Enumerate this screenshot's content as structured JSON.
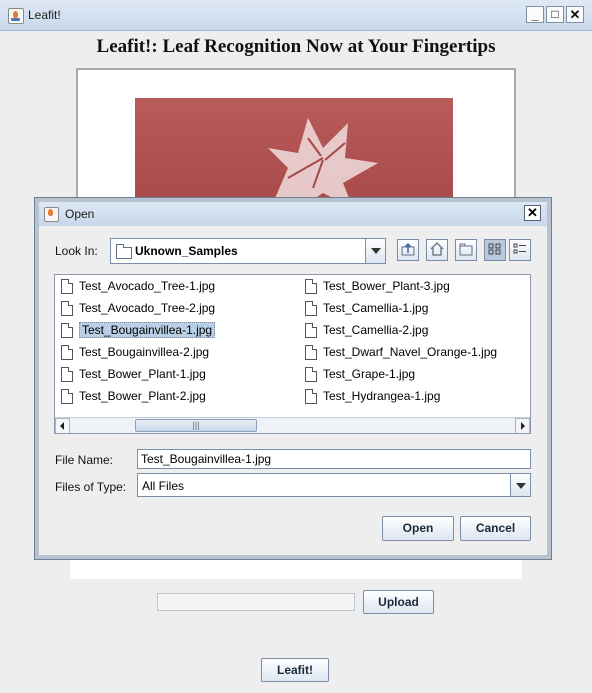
{
  "window": {
    "title": "Leafit!",
    "minimize": "_",
    "maximize": "□",
    "close": "✕"
  },
  "heading": "Leafit!: Leaf Recognition Now at Your Fingertips",
  "upload": {
    "button_label": "Upload",
    "field_value": ""
  },
  "leafit_button": "Leafit!",
  "dialog": {
    "title": "Open",
    "close": "✕",
    "look_in_label": "Look In:",
    "look_in_value": "Uknown_Samples",
    "files_left": [
      "Test_Avocado_Tree-1.jpg",
      "Test_Avocado_Tree-2.jpg",
      "Test_Bougainvillea-1.jpg",
      "Test_Bougainvillea-2.jpg",
      "Test_Bower_Plant-1.jpg",
      "Test_Bower_Plant-2.jpg"
    ],
    "files_right": [
      "Test_Bower_Plant-3.jpg",
      "Test_Camellia-1.jpg",
      "Test_Camellia-2.jpg",
      "Test_Dwarf_Navel_Orange-1.jpg",
      "Test_Grape-1.jpg",
      "Test_Hydrangea-1.jpg"
    ],
    "selected_file": "Test_Bougainvillea-1.jpg",
    "file_name_label": "File Name:",
    "file_name_value": "Test_Bougainvillea-1.jpg",
    "files_of_type_label": "Files of Type:",
    "files_of_type_value": "All Files",
    "open_button": "Open",
    "cancel_button": "Cancel"
  }
}
